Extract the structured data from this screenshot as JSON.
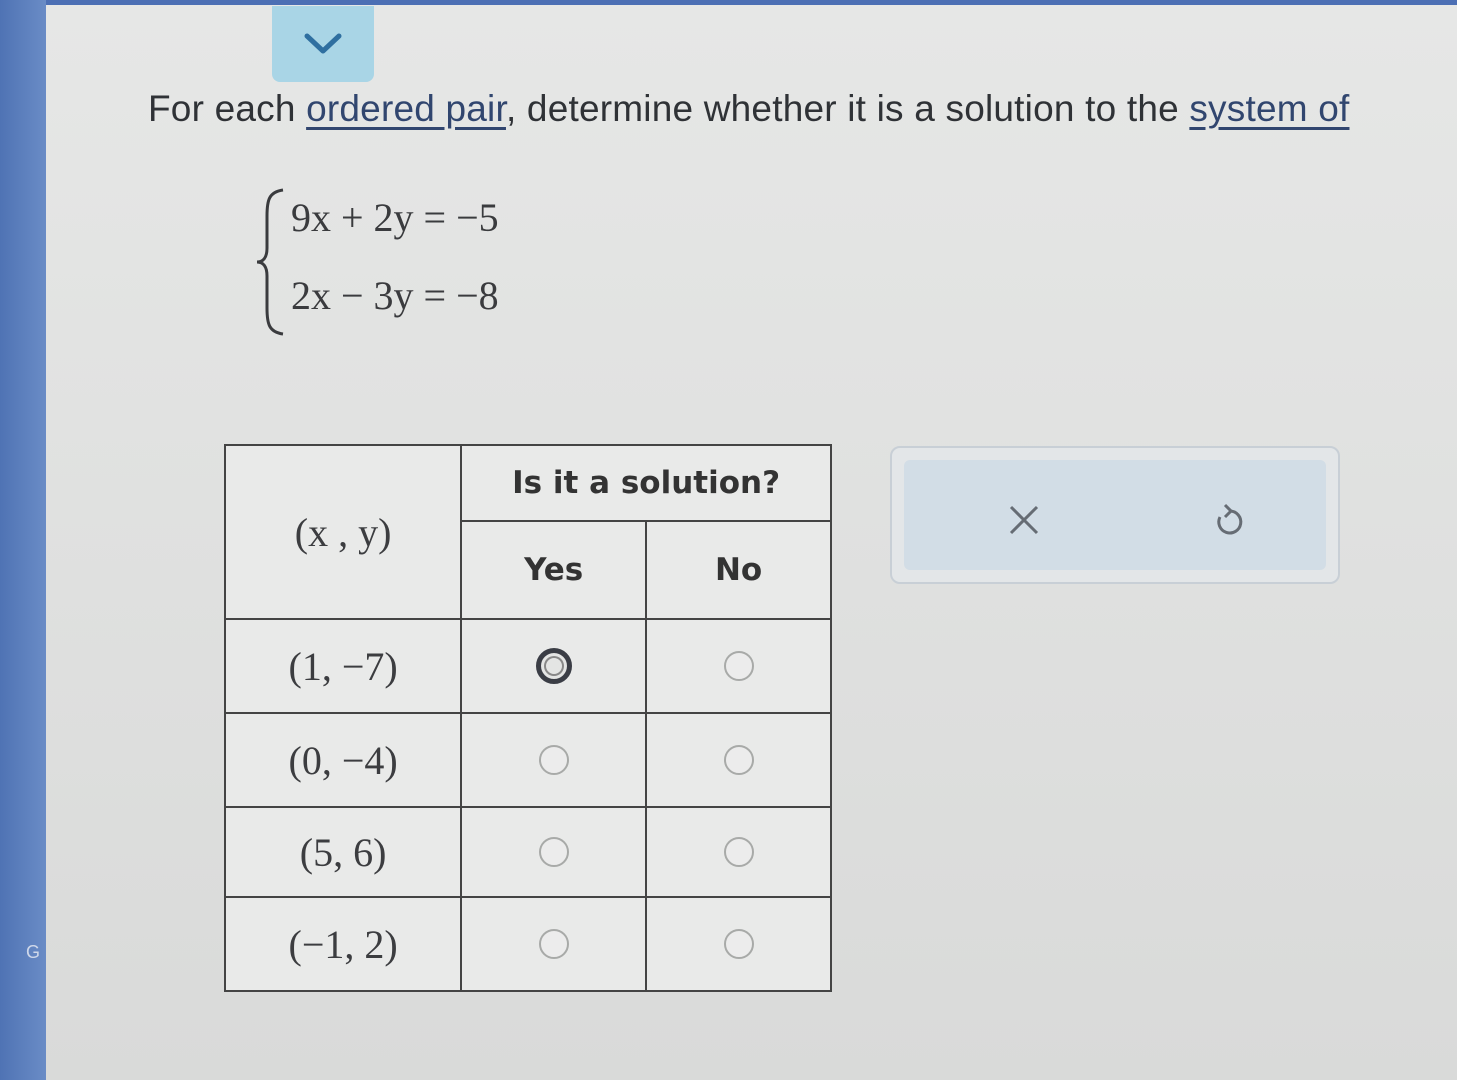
{
  "instruction": {
    "part1": "For each ",
    "link1": "ordered pair",
    "part2": ", determine whether it is a solution to the ",
    "link2": "system of"
  },
  "system": {
    "equation1": "9x + 2y = −5",
    "equation2": "2x − 3y = −8"
  },
  "table": {
    "pair_header": "(x , y)",
    "question_header": "Is it a solution?",
    "yes_label": "Yes",
    "no_label": "No",
    "rows": [
      {
        "pair": "(1, −7)"
      },
      {
        "pair": "(0, −4)"
      },
      {
        "pair": "(5, 6)"
      },
      {
        "pair": "(−1, 2)"
      }
    ]
  },
  "icons": {
    "collapse": "chevron-down-icon",
    "clear": "close-icon",
    "undo": "undo-icon"
  },
  "colors": {
    "accent": "#4c6fb4",
    "tab": "#a9d5e6",
    "link": "#31466f"
  }
}
